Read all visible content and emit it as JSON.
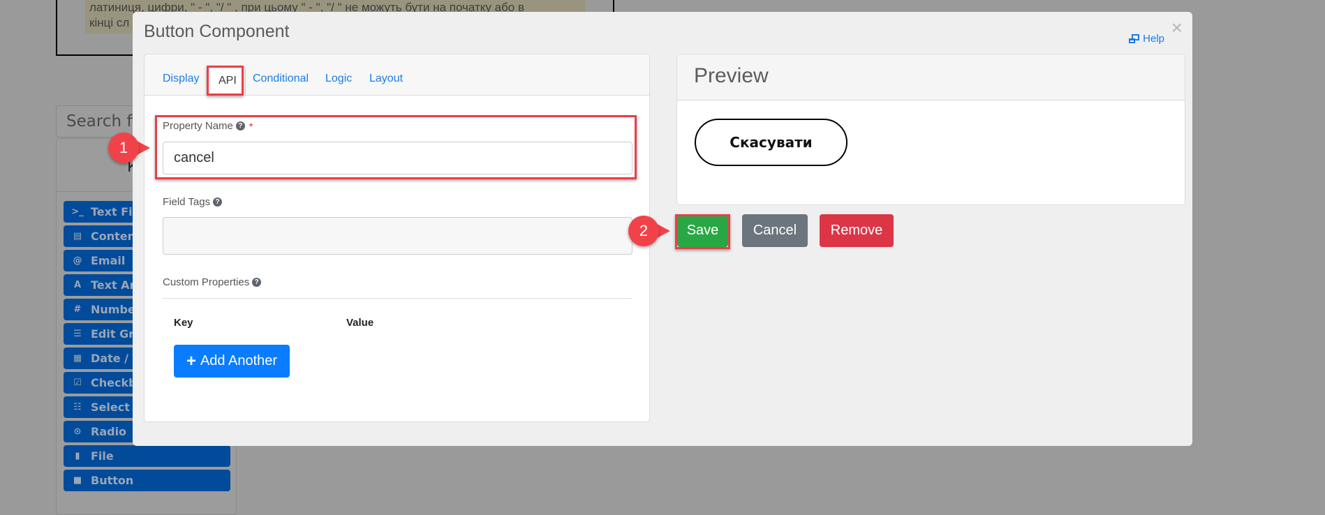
{
  "background": {
    "doc_text_line1": "латиниця, цифри, \" - \", \"/ \" , при цьому  \" - \", \"/ \" не можуть бути на початку або в",
    "doc_text_line2": "кінці сл",
    "search_placeholder": "Search fi",
    "sidebar_title": "Комп",
    "sidebar_items": [
      {
        "icon": "terminal-icon",
        "glyph": ">_",
        "label": "Text Fiel"
      },
      {
        "icon": "html5-icon",
        "glyph": "▤",
        "label": "Content"
      },
      {
        "icon": "at-icon",
        "glyph": "@",
        "label": "Email"
      },
      {
        "icon": "font-icon",
        "glyph": "A",
        "label": "Text Are"
      },
      {
        "icon": "hashtag-icon",
        "glyph": "#",
        "label": "Number"
      },
      {
        "icon": "tasks-icon",
        "glyph": "☰",
        "label": "Edit Gric"
      },
      {
        "icon": "calendar-icon",
        "glyph": "▦",
        "label": "Date / Ti"
      },
      {
        "icon": "check-square-icon",
        "glyph": "☑",
        "label": "Checkbo"
      },
      {
        "icon": "list-icon",
        "glyph": "☷",
        "label": "Select"
      },
      {
        "icon": "dot-circle-icon",
        "glyph": "⊙",
        "label": "Radio"
      },
      {
        "icon": "file-icon",
        "glyph": "▮",
        "label": "File"
      },
      {
        "icon": "stop-icon",
        "glyph": "■",
        "label": "Button"
      }
    ]
  },
  "modal": {
    "title": "Button Component",
    "help_label": "Help",
    "close_glyph": "×",
    "tabs": [
      {
        "label": "Display",
        "active": false
      },
      {
        "label": "API",
        "active": true
      },
      {
        "label": "Conditional",
        "active": false
      },
      {
        "label": "Logic",
        "active": false
      },
      {
        "label": "Layout",
        "active": false
      }
    ],
    "fields": {
      "property_name_label": "Property Name",
      "property_name_required": "*",
      "property_name_value": "cancel",
      "field_tags_label": "Field Tags",
      "field_tags_value": "",
      "custom_properties_label": "Custom Properties",
      "key_header": "Key",
      "value_header": "Value",
      "add_another_label": "Add Another"
    },
    "preview": {
      "title": "Preview",
      "button_label": "Скасувати"
    },
    "actions": {
      "save_label": "Save",
      "cancel_label": "Cancel",
      "remove_label": "Remove"
    }
  },
  "annotations": {
    "step1": "1",
    "step2": "2"
  },
  "colors": {
    "primary": "#0a7cff",
    "success": "#29a745",
    "secondary": "#6c757d",
    "danger": "#dc3546",
    "highlight": "#ea3e46"
  }
}
